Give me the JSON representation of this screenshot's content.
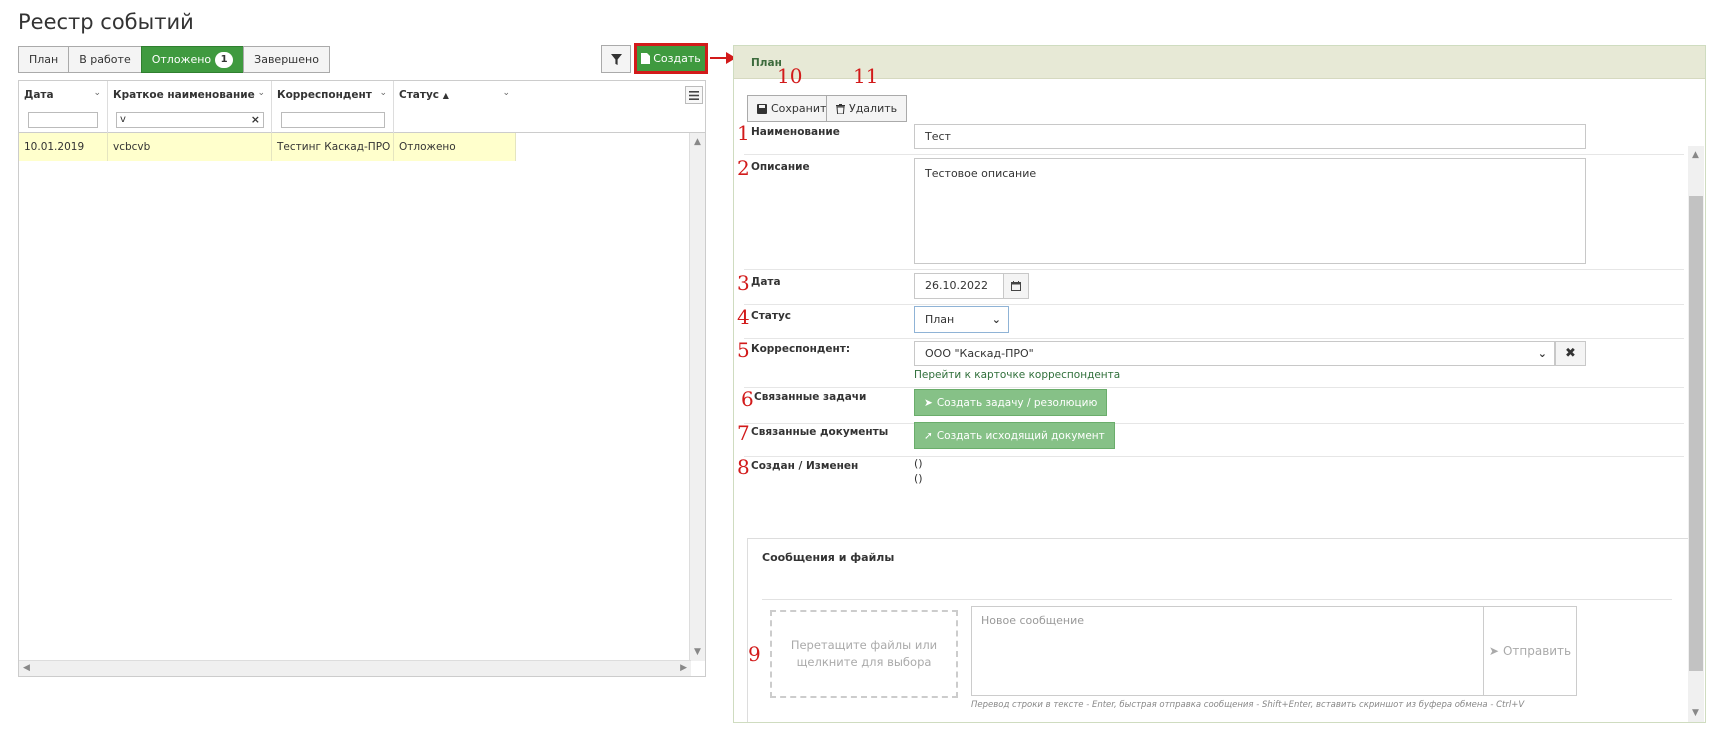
{
  "page_title": "Реестр событий",
  "tabs": [
    {
      "label": "План"
    },
    {
      "label": "В работе"
    },
    {
      "label": "Отложено",
      "badge": "1"
    },
    {
      "label": "Завершено"
    }
  ],
  "toolbar": {
    "create_label": "Создать"
  },
  "grid": {
    "columns": [
      "Дата",
      "Краткое наименование",
      "Корреспондент",
      "Статус"
    ],
    "filter_values": [
      "",
      "v",
      "",
      ""
    ],
    "rows": [
      {
        "date": "10.01.2019",
        "name": "vcbcvb",
        "correspondent": "Тестинг Каскад-ПРО",
        "status": "Отложено"
      }
    ]
  },
  "panel": {
    "title": "План",
    "save_label": "Сохранить",
    "delete_label": "Удалить",
    "fields": {
      "name_label": "Наименование",
      "name_value": "Тест",
      "description_label": "Описание",
      "description_value": "Тестовое описание",
      "date_label": "Дата",
      "date_value": "26.10.2022",
      "status_label": "Статус",
      "status_value": "План",
      "correspondent_label": "Корреспондент:",
      "correspondent_value": "ООО \"Каскад-ПРО\"",
      "correspondent_link": "Перейти к карточке корреспондента",
      "tasks_label": "Связанные задачи",
      "tasks_button": "Создать задачу / резолюцию",
      "docs_label": "Связанные документы",
      "docs_button": "Создать исходящий документ",
      "created_label": "Создан / Изменен",
      "created_value": "()",
      "modified_value": "()"
    },
    "messages": {
      "title": "Сообщения и файлы",
      "drop_text": "Перетащите файлы или щелкните для выбора",
      "placeholder": "Новое сообщение",
      "send_label": "Отправить",
      "hint": "Перевод строки в тексте - Enter, быстрая отправка сообщения - Shift+Enter, вставить скриншот из буфера обмена - Ctrl+V"
    }
  },
  "annotations": {
    "n1": "1",
    "n2": "2",
    "n3": "3",
    "n4": "4",
    "n5": "5",
    "n6": "6",
    "n7": "7",
    "n8": "8",
    "n9": "9",
    "n10": "10",
    "n11": "11"
  },
  "colors": {
    "accent_green": "#3f9a3f",
    "highlight_red": "#d21a1a",
    "row_highlight": "#ffffcc",
    "panel_header": "#e7e9d6"
  }
}
